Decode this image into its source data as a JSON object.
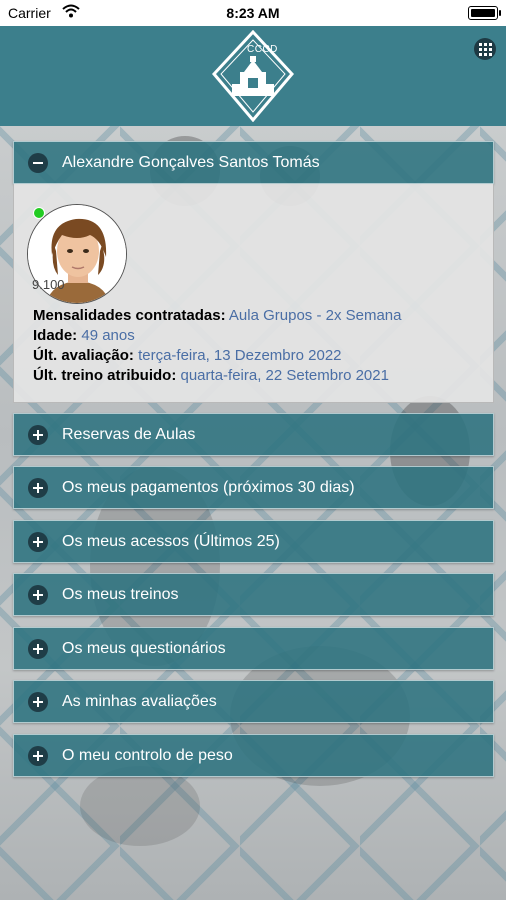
{
  "status_bar": {
    "carrier": "Carrier",
    "time": "8:23 AM"
  },
  "header": {
    "logo_text": "CCCD",
    "menu_icon": "grid-icon"
  },
  "colors": {
    "header": "#3c7f8c",
    "panel": "#2d7380",
    "link": "#4a6ea5",
    "online": "#22cc22"
  },
  "profile": {
    "name": "Alexandre Gonçalves Santos Tomás",
    "member_id": "9.100",
    "fields": [
      {
        "label": "Mensalidades contratadas:",
        "value": "Aula Grupos - 2x Semana"
      },
      {
        "label": "Idade:",
        "value": "49 anos"
      },
      {
        "label": "Últ. avaliação:",
        "value": "terça-feira, 13 Dezembro 2022"
      },
      {
        "label": "Últ. treino atribuido:",
        "value": "quarta-feira, 22 Setembro 2021"
      }
    ]
  },
  "sections": [
    {
      "label": "Reservas de Aulas"
    },
    {
      "label": "Os meus pagamentos (próximos 30 dias)"
    },
    {
      "label": "Os meus acessos (Últimos 25)"
    },
    {
      "label": "Os meus treinos"
    },
    {
      "label": "Os meus questionários"
    },
    {
      "label": "As minhas avaliações"
    },
    {
      "label": "O meu controlo de peso"
    }
  ]
}
